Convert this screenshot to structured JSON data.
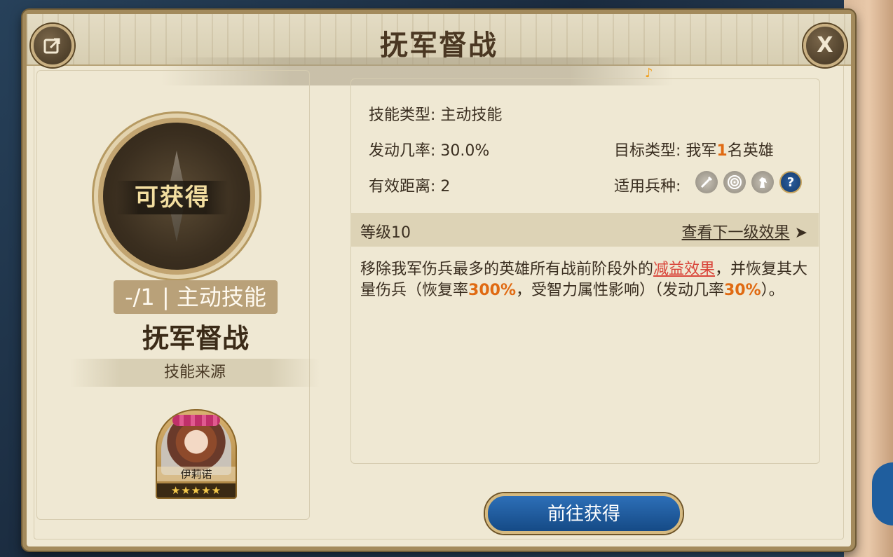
{
  "dialog": {
    "title": "抚军督战"
  },
  "skill": {
    "status_label": "可获得",
    "type_tag": "-/1 | 主动技能",
    "name": "抚军督战",
    "source_label": "技能来源"
  },
  "hero": {
    "name": "伊莉诺",
    "stars": "★★★★★"
  },
  "info": {
    "skill_type": "技能类型: 主动技能",
    "trigger_rate": "发动几率: 30.0%",
    "effective_range": "有效距离: 2",
    "target_type_prefix": "目标类型: 我军",
    "target_type_count": "1",
    "target_type_suffix": "名英雄",
    "troop_label": "适用兵种:",
    "troop_icons": [
      "sword-icon",
      "target-icon",
      "horse-icon",
      "question-icon"
    ]
  },
  "level": {
    "label": "等级10",
    "next_link": "查看下一级效果",
    "next_arrow": "➤"
  },
  "description": {
    "part1": "移除我军伤兵最多的英雄所有战前阶段外的",
    "link": "减益效果",
    "part2": "，并恢复其大量伤兵（恢复率",
    "value1": "300%",
    "part3": "，受智力属性影响）（发动几率",
    "value2": "30%",
    "part4": "）。"
  },
  "actions": {
    "obtain_button": "前往获得"
  },
  "colors": {
    "highlight": "#e06a12",
    "link_red": "#d9453a",
    "button_blue": "#1f5e9e"
  }
}
